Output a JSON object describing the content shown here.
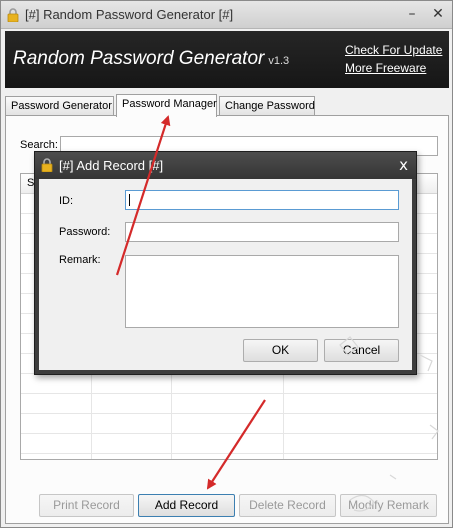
{
  "window": {
    "title": "[#] Random Password Generator [#]",
    "minimize_glyph": "–",
    "close_glyph": "✕"
  },
  "banner": {
    "app_name": "Random Password Generator",
    "version": "v1.3",
    "links": [
      "Check For Update",
      "More Freeware"
    ]
  },
  "tabs": [
    {
      "label": "Password Generator",
      "active": false
    },
    {
      "label": "Password Manager",
      "active": true
    },
    {
      "label": "Change Password",
      "active": false
    }
  ],
  "search": {
    "label": "Search:",
    "value": ""
  },
  "grid": {
    "partial_header": "St"
  },
  "buttons": {
    "print": "Print Record",
    "add": "Add Record",
    "delete": "Delete Record",
    "modify": "Modify Remark"
  },
  "dialog": {
    "title": "[#] Add Record [#]",
    "close_glyph": "x",
    "fields": {
      "id_label": "ID:",
      "password_label": "Password:",
      "remark_label": "Remark:"
    },
    "values": {
      "id": "",
      "password": "",
      "remark": ""
    },
    "ok": "OK",
    "cancel": "Cancel"
  },
  "icons": {
    "app": "lock-icon",
    "dialog": "lock-icon"
  },
  "colors": {
    "banner_bg": "#1f1f1f",
    "dialog_frame": "#3d3d3d",
    "annotation_arrow": "#d42a2a",
    "lock": "#e8b21f"
  }
}
